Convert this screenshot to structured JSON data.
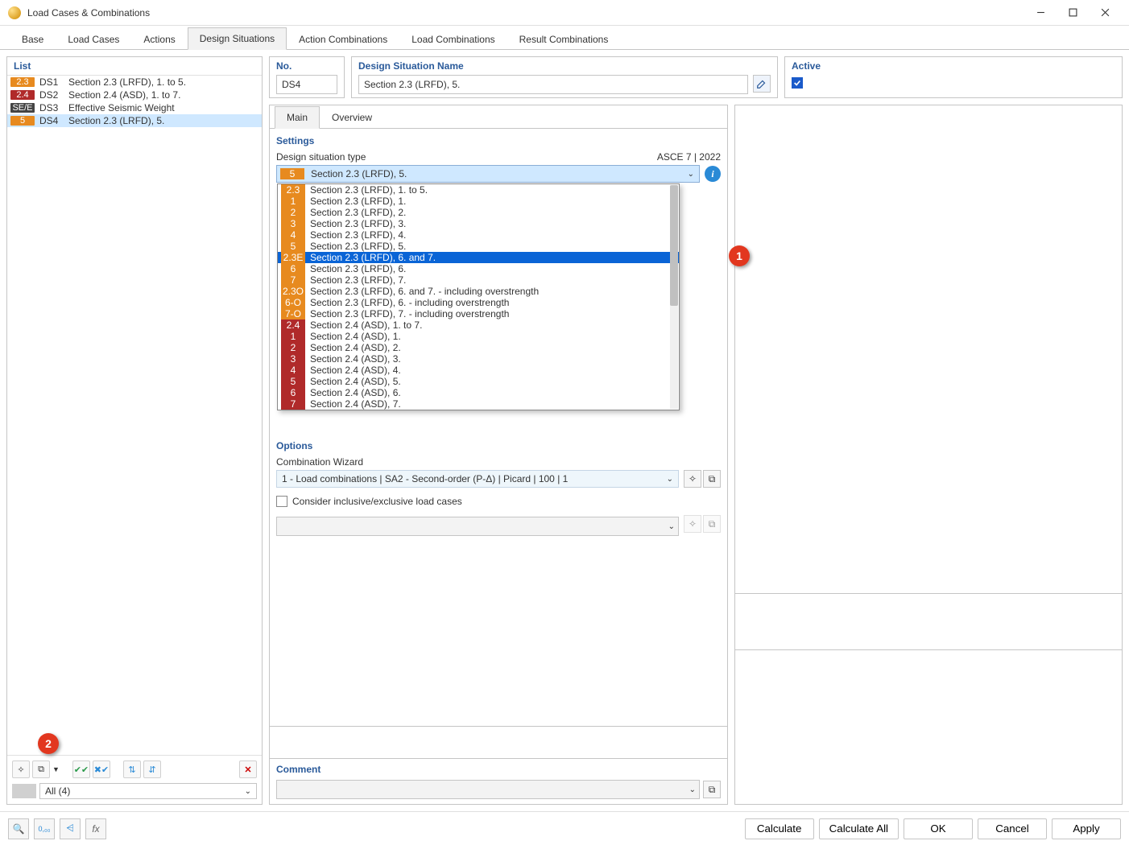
{
  "window": {
    "title": "Load Cases & Combinations"
  },
  "tabs": [
    "Base",
    "Load Cases",
    "Actions",
    "Design Situations",
    "Action Combinations",
    "Load Combinations",
    "Result Combinations"
  ],
  "active_tab": "Design Situations",
  "left": {
    "title": "List",
    "items": [
      {
        "badge": "2.3",
        "badge_color": "#e78a1f",
        "id": "DS1",
        "name": "Section 2.3 (LRFD), 1. to 5."
      },
      {
        "badge": "2.4",
        "badge_color": "#b02a2a",
        "id": "DS2",
        "name": "Section 2.4 (ASD), 1. to 7."
      },
      {
        "badge": "SE/E",
        "badge_color": "#444444",
        "id": "DS3",
        "name": "Effective Seismic Weight"
      },
      {
        "badge": "5",
        "badge_color": "#e78a1f",
        "id": "DS4",
        "name": "Section 2.3 (LRFD), 5."
      }
    ],
    "selected": "DS4",
    "filter": "All (4)"
  },
  "header": {
    "no_label": "No.",
    "no_value": "DS4",
    "name_label": "Design Situation Name",
    "name_value": "Section 2.3 (LRFD), 5.",
    "active_label": "Active",
    "active_checked": true
  },
  "subtabs": [
    "Main",
    "Overview"
  ],
  "subtab_active": "Main",
  "settings": {
    "title": "Settings",
    "dst_label": "Design situation type",
    "dst_standard": "ASCE 7 | 2022",
    "dst_selected": {
      "badge": "5",
      "badge_color": "#e78a1f",
      "text": "Section 2.3 (LRFD), 5."
    }
  },
  "dropdown": {
    "highlight_index": 5,
    "items": [
      {
        "badge": "2.3",
        "bg": "#e78a1f",
        "text": "Section 2.3 (LRFD), 1. to 5."
      },
      {
        "badge": "1",
        "bg": "#e78a1f",
        "text": "Section 2.3 (LRFD), 1."
      },
      {
        "badge": "2",
        "bg": "#e78a1f",
        "text": "Section 2.3 (LRFD), 2."
      },
      {
        "badge": "3",
        "bg": "#e78a1f",
        "text": "Section 2.3 (LRFD), 3."
      },
      {
        "badge": "4",
        "bg": "#e78a1f",
        "text": "Section 2.3 (LRFD), 4."
      },
      {
        "badge": "5",
        "bg": "#e78a1f",
        "text": "Section 2.3 (LRFD), 5."
      },
      {
        "badge": "2.3E",
        "bg": "#e78a1f",
        "text": "Section 2.3 (LRFD), 6. and 7."
      },
      {
        "badge": "6",
        "bg": "#e78a1f",
        "text": "Section 2.3 (LRFD), 6."
      },
      {
        "badge": "7",
        "bg": "#e78a1f",
        "text": "Section 2.3 (LRFD), 7."
      },
      {
        "badge": "2.3O",
        "bg": "#e78a1f",
        "text": "Section 2.3 (LRFD), 6. and 7. - including overstrength"
      },
      {
        "badge": "6-O",
        "bg": "#e78a1f",
        "text": "Section 2.3 (LRFD), 6. - including overstrength"
      },
      {
        "badge": "7-O",
        "bg": "#e78a1f",
        "text": "Section 2.3 (LRFD), 7. - including overstrength"
      },
      {
        "badge": "2.4",
        "bg": "#b02a2a",
        "text": "Section 2.4 (ASD), 1. to 7."
      },
      {
        "badge": "1",
        "bg": "#b02a2a",
        "text": "Section 2.4 (ASD), 1."
      },
      {
        "badge": "2",
        "bg": "#b02a2a",
        "text": "Section 2.4 (ASD), 2."
      },
      {
        "badge": "3",
        "bg": "#b02a2a",
        "text": "Section 2.4 (ASD), 3."
      },
      {
        "badge": "4",
        "bg": "#b02a2a",
        "text": "Section 2.4 (ASD), 4."
      },
      {
        "badge": "5",
        "bg": "#b02a2a",
        "text": "Section 2.4 (ASD), 5."
      },
      {
        "badge": "6",
        "bg": "#b02a2a",
        "text": "Section 2.4 (ASD), 6."
      },
      {
        "badge": "7",
        "bg": "#b02a2a",
        "text": "Section 2.4 (ASD), 7."
      }
    ]
  },
  "options": {
    "title": "Options",
    "wizard_label": "Combination Wizard",
    "wizard_value": "1 - Load combinations | SA2 - Second-order (P-Δ) | Picard | 100 | 1",
    "consider_label": "Consider inclusive/exclusive load cases"
  },
  "comment": {
    "label": "Comment"
  },
  "footer": {
    "calculate": "Calculate",
    "calculate_all": "Calculate All",
    "ok": "OK",
    "cancel": "Cancel",
    "apply": "Apply"
  },
  "callouts": {
    "c1": "1",
    "c2": "2"
  }
}
